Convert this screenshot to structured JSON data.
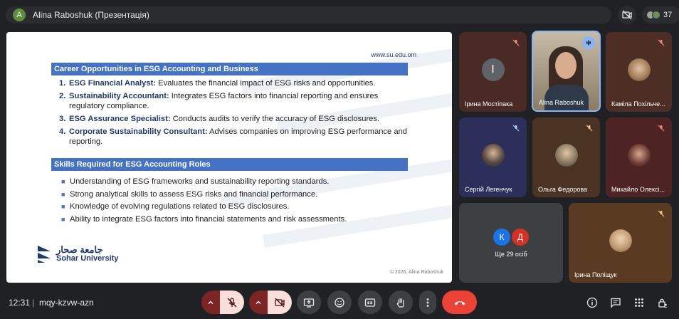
{
  "top_bar": {
    "presenter_initial": "A",
    "presenter_title": "Alina Raboshuk (Презентація)",
    "participant_count": "37"
  },
  "slide": {
    "url": "www.su.edu.om",
    "section1_title": "Career Opportunities in ESG Accounting and Business",
    "careers": [
      {
        "num": "1.",
        "term": "ESG Financial Analyst:",
        "desc": " Evaluates the financial impact of ESG risks and opportunities."
      },
      {
        "num": "2.",
        "term": "Sustainability Accountant:",
        "desc": " Integrates ESG factors into financial reporting and ensures regulatory compliance."
      },
      {
        "num": "3.",
        "term": "ESG Assurance Specialist:",
        "desc": " Conducts audits to verify the accuracy of ESG disclosures."
      },
      {
        "num": "4.",
        "term": "Corporate Sustainability Consultant:",
        "desc": " Advises companies on improving ESG performance and reporting."
      }
    ],
    "section2_title": "Skills Required for ESG Accounting Roles",
    "skills": [
      "Understanding of ESG frameworks and sustainability reporting standards.",
      "Strong analytical skills to assess ESG risks and financial performance.",
      "Knowledge of evolving regulations related to ESG disclosures.",
      "Ability to integrate ESG factors into financial statements and risk assessments."
    ],
    "logo_arabic": "جامعة صحار",
    "logo_english": "Sohar University",
    "copyright": "© 2026, Alina Raboshuk"
  },
  "participants": [
    {
      "name": "Ірина Мостіпака",
      "initial": "І",
      "muted": true
    },
    {
      "name": "Alina Raboshuk",
      "speaking": true
    },
    {
      "name": "Каміла Похільче...",
      "muted": true
    },
    {
      "name": "Сергій Легенчук",
      "muted": true
    },
    {
      "name": "Ольга Федорова",
      "muted": true
    },
    {
      "name": "Михайло Олексі...",
      "muted": true
    },
    {
      "name": "Ірина Поліщук",
      "muted": true
    }
  ],
  "others": {
    "label": "Ще 29 осіб",
    "initial_a": "К",
    "initial_b": "Д"
  },
  "bottom_bar": {
    "time": "12:31",
    "separator": "|",
    "meeting_code": "mqy-kzvw-azn"
  },
  "colors": {
    "accent": "#8ab4f8",
    "end_call": "#ea4335",
    "mic_off_bg": "#f9dedc",
    "slide_header": "#4472c4"
  }
}
